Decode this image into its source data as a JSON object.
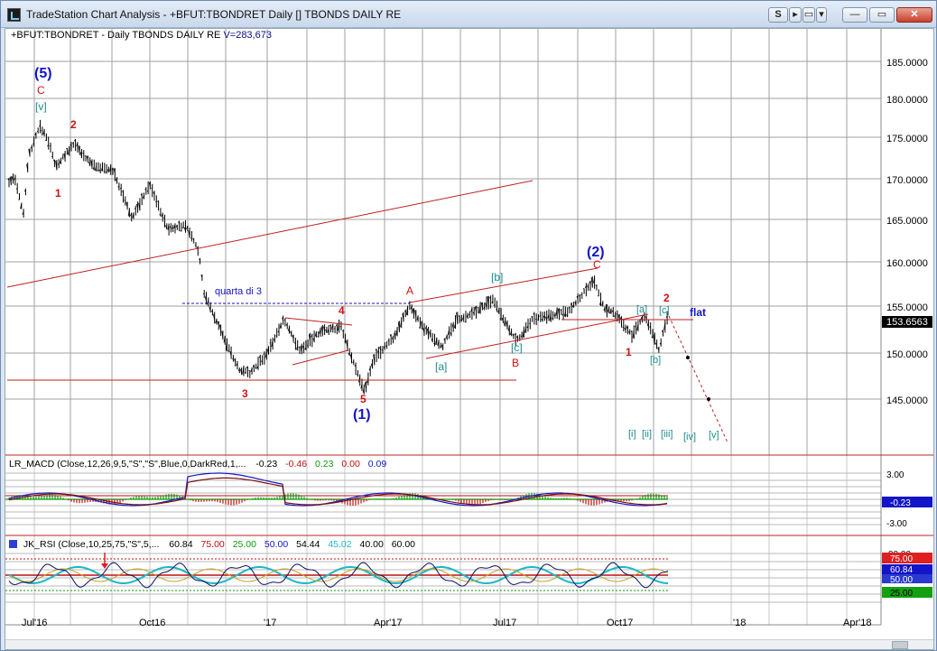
{
  "window": {
    "title": "TradeStation Chart Analysis - +BFUT:TBONDRET Daily [] TBONDS DAILY RE",
    "buttons": {
      "s": "S",
      "tools": "▸",
      "restore": "▭",
      "dropdown": "▾",
      "minimize": "—",
      "maximize": "▭",
      "close": "✕"
    }
  },
  "symbol": {
    "label": "+BFUT:TBONDRET - Daily  TBONDS DAILY RE",
    "volume": "V=283,673"
  },
  "price_axis": {
    "labels": [
      "185.0000",
      "180.0000",
      "175.0000",
      "170.0000",
      "165.0000",
      "160.0000",
      "155.0000",
      "150.0000",
      "145.0000"
    ],
    "last_price": "153.6563"
  },
  "time_axis": {
    "labels": [
      "Jul'16",
      "Oct16",
      "'17",
      "Apr'17",
      "Jul17",
      "Oct17",
      "'18",
      "Apr'18"
    ]
  },
  "wave_labels": {
    "w5_big": "(5)",
    "c_top": "C",
    "v_top": "[v]",
    "two_top": "2",
    "one_left": "1",
    "quarta": "quarta di 3",
    "four": "4",
    "three": "3",
    "five": "5",
    "w1_big": "(1)",
    "a_mid": "A",
    "b_box": "[b]",
    "a_box": "[a]",
    "c_box": "[c]",
    "b_mid": "B",
    "w2_big": "(2)",
    "c_right": "C",
    "a_box2": "[a]",
    "c_box2": "[c]",
    "two_right": "2",
    "flat": "flat",
    "one_right": "1",
    "b_box2": "[b]",
    "i": "[i]",
    "ii": "[ii]",
    "iii": "[iii]",
    "iv": "[iv]",
    "v": "[v]"
  },
  "macd": {
    "legend_name": "LR_MACD (Close,12,26,9,5,\"S\",\"S\",Blue,0,DarkRed,1,...",
    "v1": "-0.23",
    "v2": "-0.46",
    "v3": "0.23",
    "v4": "0.00",
    "v5": "0.09",
    "axis_top": "3.00",
    "axis_bottom": "-3.00",
    "current": "-0.23"
  },
  "rsi": {
    "legend_name": "JK_RSI (Close,10,25,75,\"S\",5,...",
    "v1": "60.84",
    "v2": "75.00",
    "v3": "25.00",
    "v4": "50.00",
    "v5": "54.44",
    "v6": "45.02",
    "v7": "40.00",
    "v8": "60.00",
    "axis_top": "90.00",
    "box_75": "75.00",
    "box_current": "60.84",
    "box_50": "50.00",
    "box_25": "25.00"
  },
  "colors": {
    "red": "#d01010",
    "blue": "#1414c8",
    "teal": "#1a8a8a",
    "green": "#0a9a0a"
  }
}
